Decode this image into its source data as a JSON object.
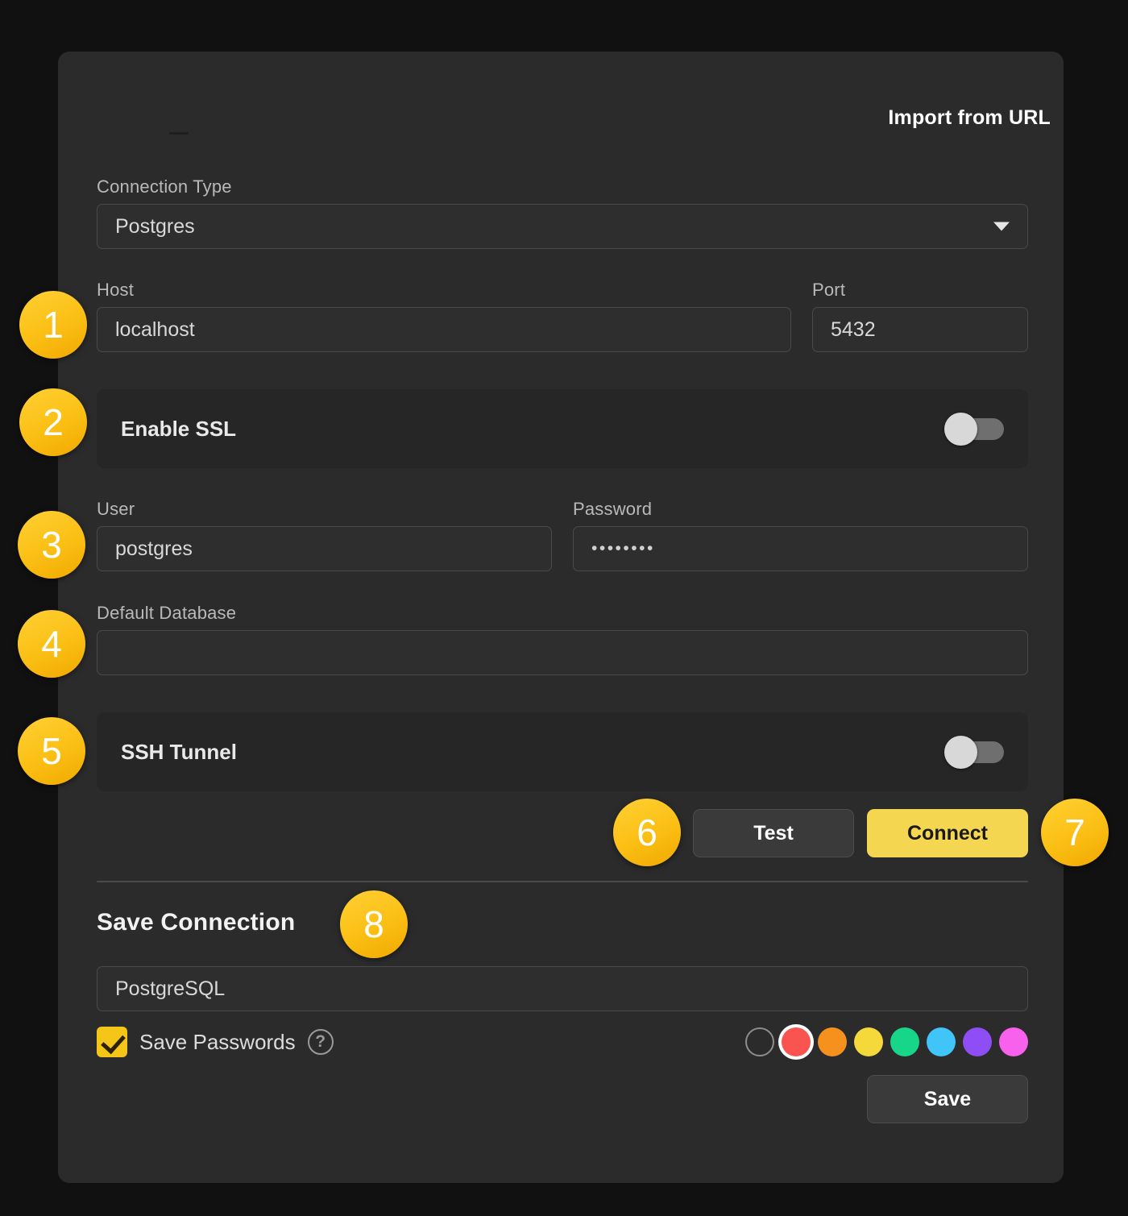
{
  "dialog": {
    "import_from_url": "Import from URL"
  },
  "form": {
    "connection_type": {
      "label": "Connection Type",
      "value": "Postgres",
      "options": [
        "Postgres"
      ]
    },
    "host": {
      "label": "Host",
      "value": "localhost"
    },
    "port": {
      "label": "Port",
      "value": "5432"
    },
    "enable_ssl": {
      "label": "Enable SSL",
      "state": "off"
    },
    "user": {
      "label": "User",
      "value": "postgres"
    },
    "password": {
      "label": "Password",
      "value": "••••••••"
    },
    "default_database": {
      "label": "Default Database",
      "value": ""
    },
    "ssh_tunnel": {
      "label": "SSH Tunnel",
      "state": "off"
    }
  },
  "actions": {
    "test": "Test",
    "connect": "Connect"
  },
  "save_section": {
    "title": "Save Connection",
    "name_value": "PostgreSQL",
    "save_passwords_label": "Save Passwords",
    "save_passwords_checked": true,
    "help_icon": "question-mark-icon",
    "save_button": "Save",
    "colors": [
      {
        "name": "none",
        "hex": "transparent",
        "selected": false
      },
      {
        "name": "red",
        "hex": "#f9544f",
        "selected": true
      },
      {
        "name": "orange",
        "hex": "#f7911e",
        "selected": false
      },
      {
        "name": "yellow",
        "hex": "#f5d93a",
        "selected": false
      },
      {
        "name": "green",
        "hex": "#17d68a",
        "selected": false
      },
      {
        "name": "cyan",
        "hex": "#41c4f7",
        "selected": false
      },
      {
        "name": "purple",
        "hex": "#8f4df5",
        "selected": false
      },
      {
        "name": "magenta",
        "hex": "#f761ec",
        "selected": false
      }
    ]
  },
  "annotations": {
    "badges": [
      {
        "number": "1",
        "target": "host-port-row"
      },
      {
        "number": "2",
        "target": "enable-ssl-toggle"
      },
      {
        "number": "3",
        "target": "user-password-row"
      },
      {
        "number": "4",
        "target": "default-database-field"
      },
      {
        "number": "5",
        "target": "ssh-tunnel-toggle"
      },
      {
        "number": "6",
        "target": "test-button"
      },
      {
        "number": "7",
        "target": "connect-button"
      },
      {
        "number": "8",
        "target": "save-connection-title"
      }
    ]
  },
  "theme": {
    "background": "#111111",
    "panel": "#2b2b2b",
    "accent": "#f5d651",
    "badge": "#fbbf14"
  }
}
